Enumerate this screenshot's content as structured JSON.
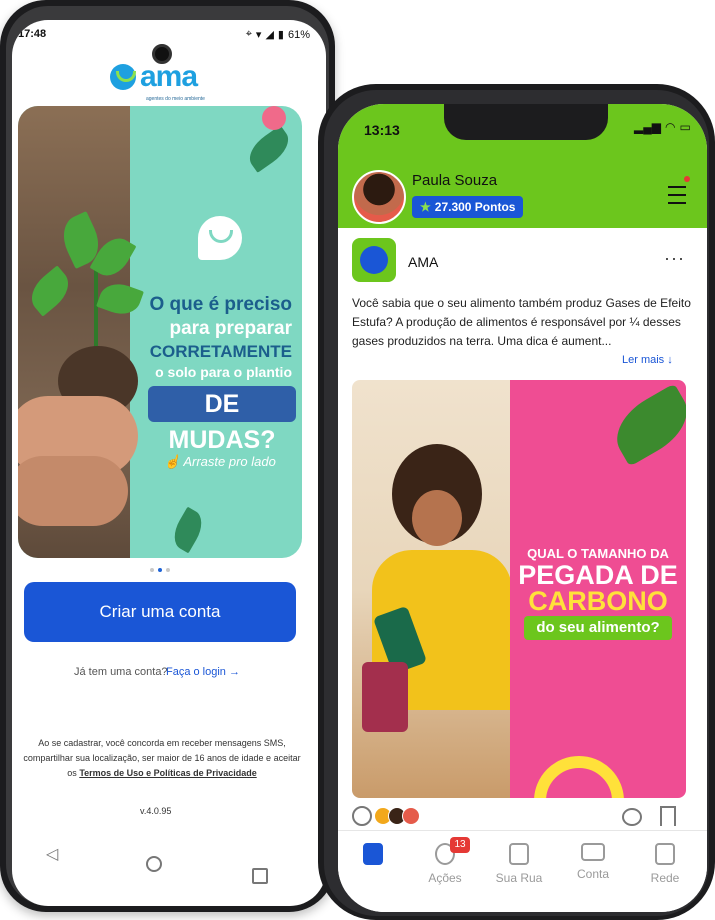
{
  "android": {
    "status": {
      "time": "17:48",
      "battery": "61%"
    },
    "logo": {
      "word": "ama",
      "tagline": "agentes do meio ambiente"
    },
    "banner": {
      "line1": "O que é preciso",
      "line2": "para preparar",
      "line3": "CORRETAMENTE",
      "line4": "o solo para o plantio",
      "line5": "DE MUDAS?",
      "swipe": "Arraste pro lado"
    },
    "carousel": {
      "count": 3,
      "active": 1
    },
    "create_account": "Criar uma conta",
    "login_question": "Já tem uma conta?",
    "login_link": "Faça o login",
    "terms_text": "Ao se cadastrar, você concorda em receber mensagens SMS, compartilhar sua localização, ser maior de 16 anos de idade e aceitar os",
    "terms_link": "Termos de Uso e Políticas de Privacidade",
    "version": "v.4.0.95",
    "nav": {
      "back": "back-icon",
      "home": "home-icon",
      "recent": "recent-apps-icon"
    }
  },
  "iphone": {
    "status": {
      "time": "13:13"
    },
    "user": {
      "name": "Paula Souza",
      "points": "27.300 Pontos"
    },
    "post": {
      "author": "AMA",
      "text": "Você sabia que o seu alimento também produz Gases de Efeito Estufa? A produção de alimentos é responsável por ¼ desses gases produzidos na terra. Uma dica é aument...",
      "read_more": "Ler mais",
      "image": {
        "line1": "QUAL O TAMANHO DA",
        "line2": "PEGADA DE",
        "line3": "CARBONO",
        "line4": "do seu alimento?"
      }
    },
    "tabs": [
      {
        "label": "",
        "icon": "document-icon",
        "active": true
      },
      {
        "label": "Ações",
        "icon": "chat-icon",
        "badge": "13"
      },
      {
        "label": "Sua Rua",
        "icon": "house-icon"
      },
      {
        "label": "Conta",
        "icon": "wallet-icon"
      },
      {
        "label": "Rede",
        "icon": "basket-icon"
      }
    ]
  },
  "colors": {
    "brand_blue": "#1a56d6",
    "brand_green": "#6cc61d",
    "teal": "#7fd8c2",
    "pink": "#ef4d93",
    "yellow": "#ffe13a"
  }
}
